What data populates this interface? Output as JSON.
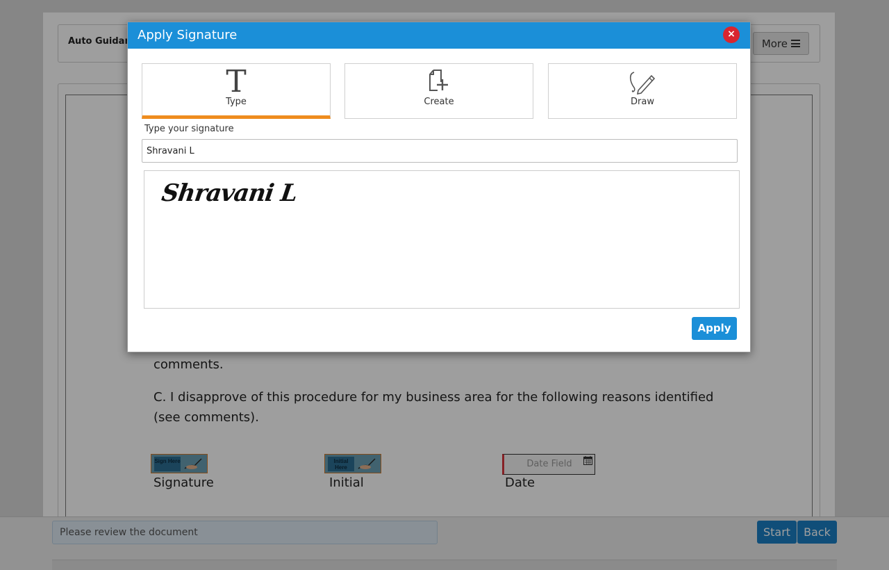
{
  "toolbar": {
    "auto_guidance": "Auto Guidance",
    "more_label": "More"
  },
  "document": {
    "partial_line": "comments.",
    "option_c": "C. I disapprove of this procedure for my business area for the following reasons identified (see comments).",
    "sign_tag_text": "Sign Here",
    "initial_tag_text": "Initial Here",
    "signature_label": "Signature",
    "initial_label": "Initial",
    "date_label": "Date",
    "date_placeholder": "Date Field"
  },
  "footer": {
    "status_text": "Please review the document",
    "start_label": "Start",
    "back_label": "Back"
  },
  "modal": {
    "title": "Apply Signature",
    "close_glyph": "×",
    "tabs": [
      {
        "label": "Type",
        "icon": "text-t-icon",
        "active": true
      },
      {
        "label": "Create",
        "icon": "new-document-icon",
        "active": false
      },
      {
        "label": "Draw",
        "icon": "pen-draw-icon",
        "active": false
      }
    ],
    "type_label": "Type your signature",
    "signature_value": "Shravani L",
    "preview_text": "Shravani L",
    "apply_label": "Apply"
  },
  "colors": {
    "header": "#1b8fd8",
    "accent_tab": "#ef8c1e",
    "close": "#d9252f",
    "button": "#1b8fd8"
  }
}
